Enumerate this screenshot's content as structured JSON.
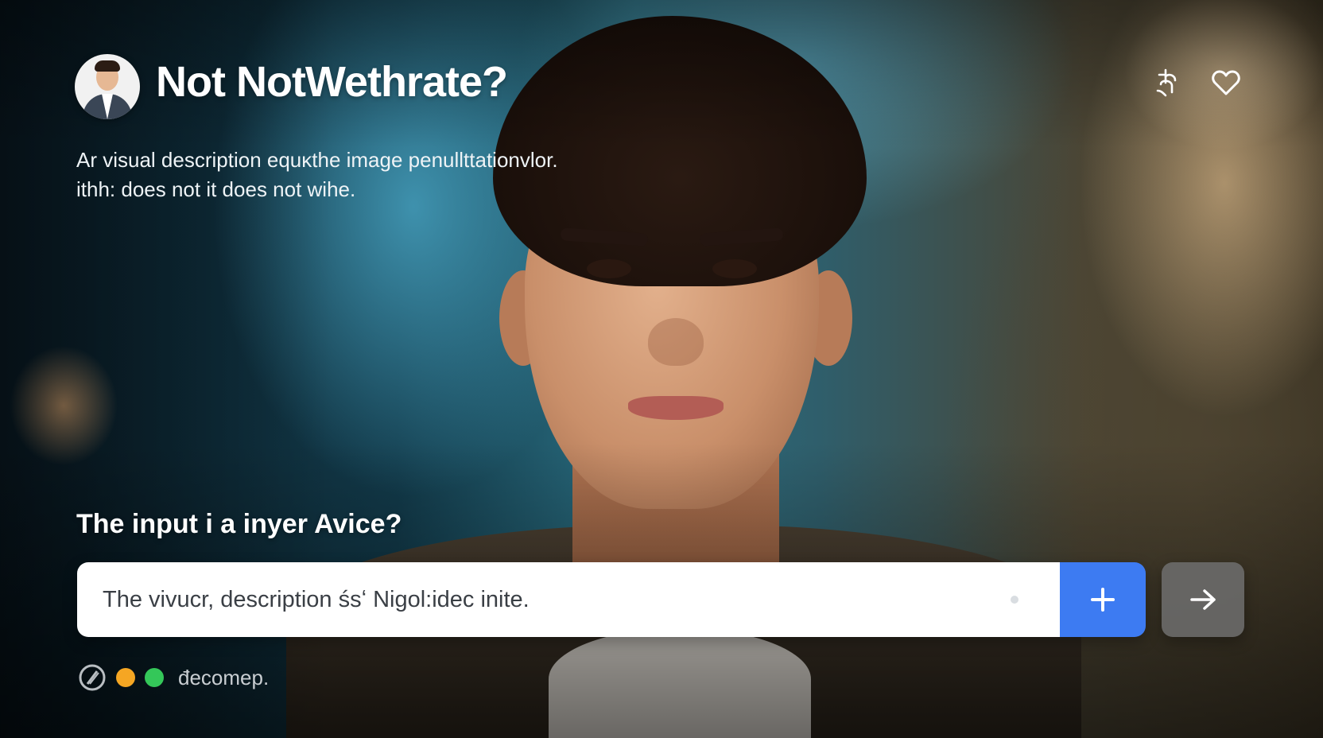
{
  "header": {
    "title": "Not NotWethrate?",
    "description_lines": [
      "Ar visual description equĸthe image penullttationvlor.",
      "ithh: does not it does not wihe."
    ]
  },
  "actions": {
    "icons": [
      "touch-gesture-icon",
      "heart-icon"
    ]
  },
  "prompt": {
    "question": "The input i a inyer Avice?",
    "input_value": "The vivucr, description śsʻ Nigol:idec inite.",
    "add_icon": "plus-icon",
    "submit_icon": "arrow-right-icon"
  },
  "status": {
    "icon": "no-entry-icon",
    "dots": [
      "#f5a623",
      "#34c759"
    ],
    "label": "đecomep."
  },
  "colors": {
    "accent": "#3d7bf2",
    "submit_bg": "#6e6e6e"
  }
}
